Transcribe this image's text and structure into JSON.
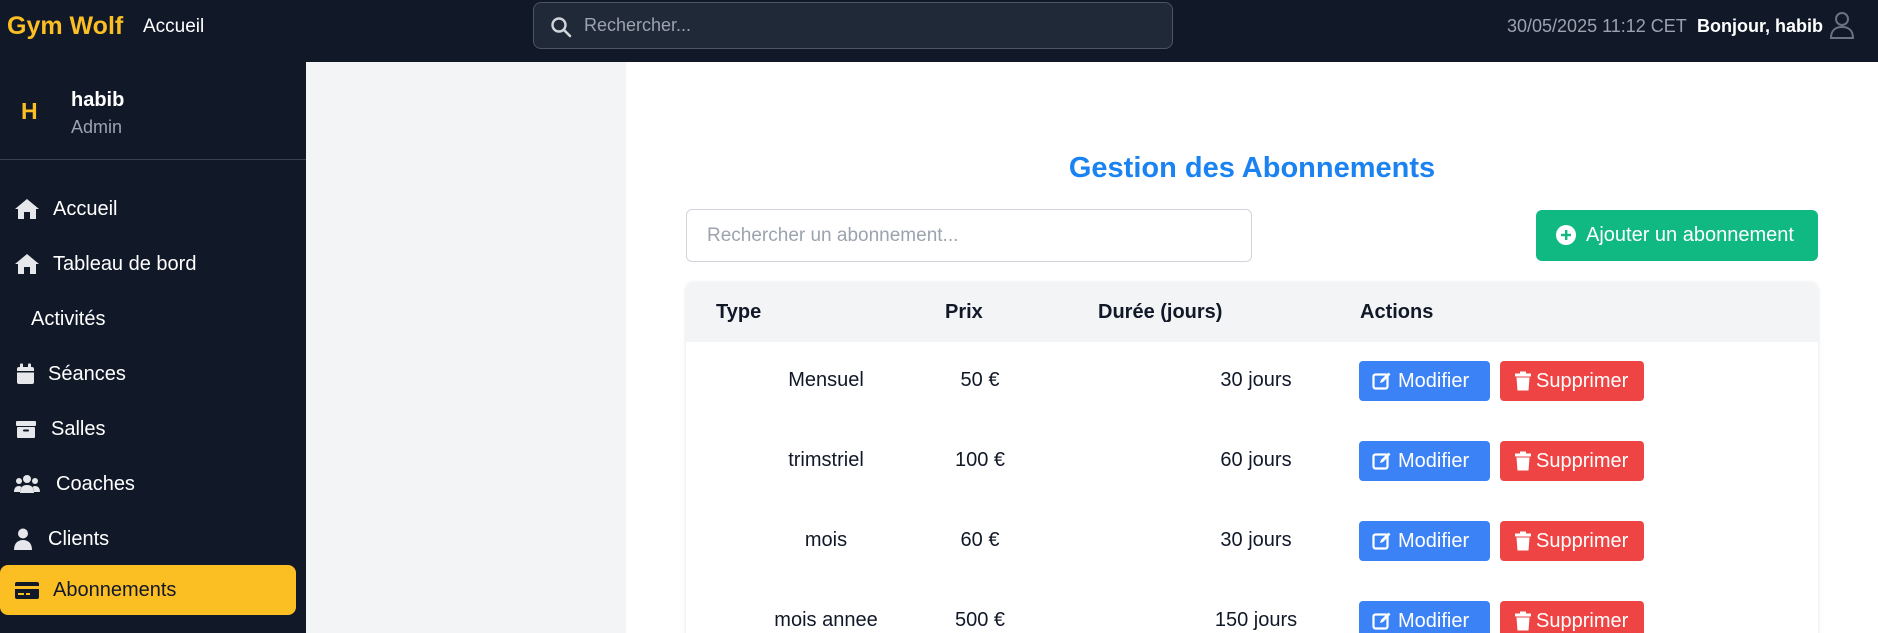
{
  "header": {
    "brand": "Gym Wolf",
    "home_link": "Accueil",
    "search_placeholder": "Rechercher...",
    "datetime": "30/05/2025 11:12 CET",
    "greeting": "Bonjour, habib"
  },
  "sidebar": {
    "profile": {
      "initial": "H",
      "name": "habib",
      "role": "Admin"
    },
    "items": [
      {
        "label": "Accueil",
        "icon": "home-icon",
        "active": false
      },
      {
        "label": "Tableau de bord",
        "icon": "home-icon",
        "active": false
      },
      {
        "label": "Activités",
        "icon": "",
        "active": false
      },
      {
        "label": "Séances",
        "icon": "calendar-icon",
        "active": false
      },
      {
        "label": "Salles",
        "icon": "archive-icon",
        "active": false
      },
      {
        "label": "Coaches",
        "icon": "users-icon",
        "active": false
      },
      {
        "label": "Clients",
        "icon": "user-icon",
        "active": false
      },
      {
        "label": "Abonnements",
        "icon": "credit-card-icon",
        "active": true
      }
    ]
  },
  "main": {
    "title": "Gestion des Abonnements",
    "search_placeholder": "Rechercher un abonnement...",
    "add_button": "Ajouter un abonnement",
    "columns": [
      "Type",
      "Prix",
      "Durée (jours)",
      "Actions"
    ],
    "rows": [
      {
        "type": "Mensuel",
        "price": "50 €",
        "duration": "30 jours"
      },
      {
        "type": "trimstriel",
        "price": "100 €",
        "duration": "60 jours"
      },
      {
        "type": "mois",
        "price": "60 €",
        "duration": "30 jours"
      },
      {
        "type": "mois annee",
        "price": "500 €",
        "duration": "150 jours"
      }
    ],
    "edit_label": "Modifier",
    "delete_label": "Supprimer"
  },
  "colors": {
    "accent": "#fbbf24",
    "title": "#1a82f1",
    "add": "#10b981",
    "edit": "#3b82f6",
    "delete": "#ef4444",
    "dark": "#111827"
  }
}
